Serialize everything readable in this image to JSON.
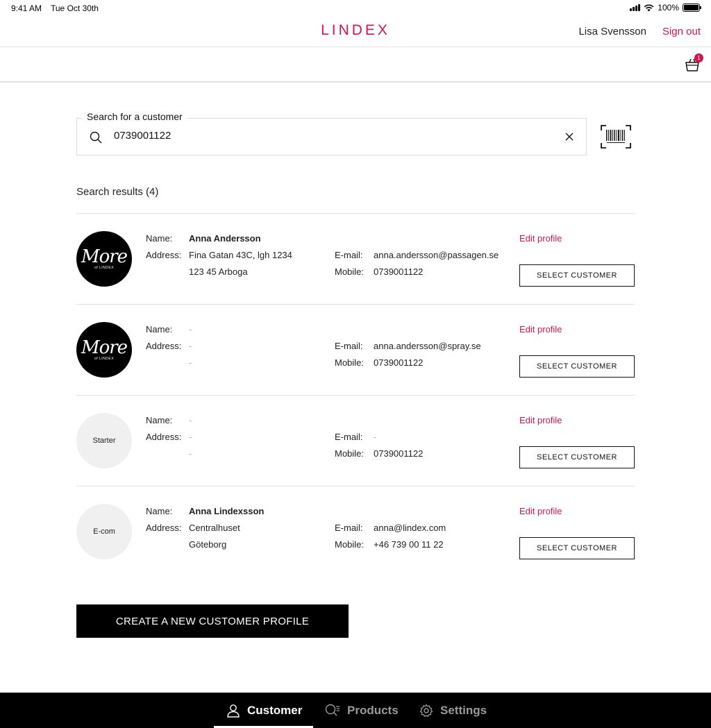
{
  "status_bar": {
    "time": "9:41 AM",
    "date": "Tue Oct 30th",
    "battery": "100%"
  },
  "header": {
    "logo": "LINDEX",
    "user_name": "Lisa Svensson",
    "sign_out": "Sign out",
    "cart_count": "1"
  },
  "search": {
    "label": "Search for a customer",
    "value": "0739001122",
    "placeholder": ""
  },
  "results_title": "Search results (4)",
  "labels": {
    "name": "Name:",
    "address": "Address:",
    "email": "E-mail:",
    "mobile": "Mobile:",
    "edit_profile": "Edit profile",
    "select_customer": "SELECT CUSTOMER"
  },
  "results": [
    {
      "avatar_type": "more",
      "avatar_text": "More",
      "avatar_sub": "of LINDEX",
      "name": "Anna Andersson",
      "address_line1": "Fina Gatan 43C, lgh 1234",
      "address_line2": "123 45 Arboga",
      "email": "anna.andersson@passagen.se",
      "mobile": "0739001122"
    },
    {
      "avatar_type": "more",
      "avatar_text": "More",
      "avatar_sub": "of LINDEX",
      "name": "-",
      "address_line1": "-",
      "address_line2": "-",
      "email": "anna.andersson@spray.se",
      "mobile": "0739001122"
    },
    {
      "avatar_type": "plain",
      "avatar_text": "Starter",
      "avatar_sub": "",
      "name": "-",
      "address_line1": "-",
      "address_line2": "-",
      "email": "-",
      "mobile": "0739001122"
    },
    {
      "avatar_type": "plain",
      "avatar_text": "E-com",
      "avatar_sub": "",
      "name": "Anna Lindexsson",
      "address_line1": "Centralhuset",
      "address_line2": "Göteborg",
      "email": "anna@lindex.com",
      "mobile": "+46 739 00 11 22"
    }
  ],
  "create_button": "CREATE A NEW CUSTOMER PROFILE",
  "tabs": [
    {
      "label": "Customer",
      "icon": "person-icon",
      "active": true
    },
    {
      "label": "Products",
      "icon": "product-search-icon",
      "active": false
    },
    {
      "label": "Settings",
      "icon": "gear-icon",
      "active": false
    }
  ],
  "colors": {
    "brand": "#d1164f",
    "tabbar": "#000000"
  }
}
